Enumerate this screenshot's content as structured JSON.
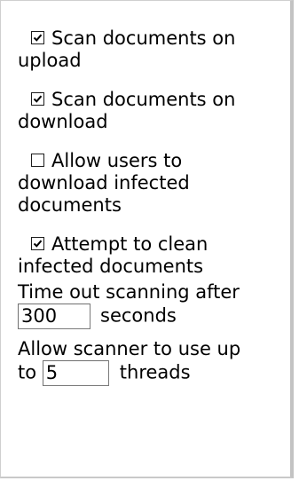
{
  "options": [
    {
      "label_a": "Scan documents on",
      "label_b": "upload",
      "checked": true
    },
    {
      "label_a": "Scan documents on",
      "label_b": "download",
      "checked": true
    },
    {
      "label_a": "Allow users to",
      "label_b": "download infected documents",
      "checked": false
    },
    {
      "label_a": "Attempt to clean",
      "label_b": "infected documents",
      "checked": true
    }
  ],
  "timeout": {
    "label": "Time out scanning after",
    "value": "300",
    "unit": "seconds"
  },
  "threads": {
    "label_a": "Allow scanner to use up",
    "prefix": "to",
    "value": "5",
    "unit": "threads"
  }
}
